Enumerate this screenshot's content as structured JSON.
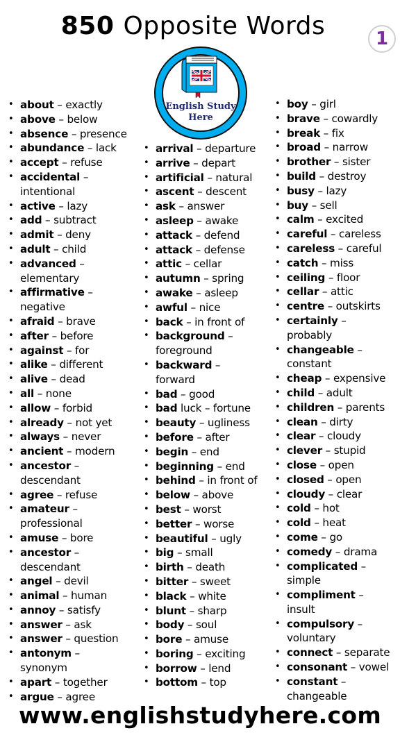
{
  "header": {
    "title_number": "850",
    "title_text": "Opposite Words",
    "page_badge": "1",
    "logo_text_line1": "English Study",
    "logo_text_line2": "Here"
  },
  "colors": {
    "logo_ring": "#00aeef",
    "logo_text": "#1f2a6b",
    "badge_number": "#7b2d9b",
    "text": "#000000"
  },
  "columns": [
    [
      {
        "word": "about",
        "extra": "",
        "opposite": "exactly"
      },
      {
        "word": "above",
        "extra": "",
        "opposite": "below"
      },
      {
        "word": "absence",
        "extra": "",
        "opposite": "presence"
      },
      {
        "word": "abundance",
        "extra": "",
        "opposite": "lack"
      },
      {
        "word": "accept",
        "extra": "",
        "opposite": "refuse"
      },
      {
        "word": "accidental",
        "extra": "",
        "opposite": "intentional",
        "wrap": true
      },
      {
        "word": "active",
        "extra": "",
        "opposite": "lazy"
      },
      {
        "word": "add",
        "extra": "",
        "opposite": "subtract"
      },
      {
        "word": "admit",
        "extra": "",
        "opposite": "deny"
      },
      {
        "word": "adult",
        "extra": "",
        "opposite": "child"
      },
      {
        "word": "advanced",
        "extra": "",
        "opposite": "elementary",
        "wrap": true
      },
      {
        "word": "affirmative",
        "extra": "",
        "opposite": "negative",
        "wrap": true
      },
      {
        "word": "afraid",
        "extra": "",
        "opposite": "brave"
      },
      {
        "word": "after",
        "extra": "",
        "opposite": "before"
      },
      {
        "word": "against",
        "extra": "",
        "opposite": "for"
      },
      {
        "word": "alike",
        "extra": "",
        "opposite": "different"
      },
      {
        "word": "alive",
        "extra": "",
        "opposite": "dead"
      },
      {
        "word": "all",
        "extra": "",
        "opposite": "none"
      },
      {
        "word": "allow",
        "extra": "",
        "opposite": "forbid"
      },
      {
        "word": "already",
        "extra": "",
        "opposite": "not yet"
      },
      {
        "word": "always",
        "extra": "",
        "opposite": "never"
      },
      {
        "word": "ancient",
        "extra": "",
        "opposite": "modern"
      },
      {
        "word": "ancestor",
        "extra": "",
        "opposite": "descendant",
        "wrap": true
      },
      {
        "word": "agree",
        "extra": "",
        "opposite": "refuse"
      },
      {
        "word": "amateur",
        "extra": "",
        "opposite": "professional",
        "wrap": true
      },
      {
        "word": "amuse",
        "extra": "",
        "opposite": "bore"
      },
      {
        "word": "ancestor",
        "extra": "",
        "opposite": "descendant",
        "wrap": true
      },
      {
        "word": "angel",
        "extra": "",
        "opposite": "devil"
      },
      {
        "word": "animal",
        "extra": "",
        "opposite": "human"
      },
      {
        "word": "annoy",
        "extra": "",
        "opposite": "satisfy"
      },
      {
        "word": "answer",
        "extra": "",
        "opposite": "ask"
      },
      {
        "word": "answer",
        "extra": "",
        "opposite": "question"
      },
      {
        "word": "antonym",
        "extra": "",
        "opposite": "synonym",
        "wrap": true
      },
      {
        "word": "apart",
        "extra": "",
        "opposite": "together"
      },
      {
        "word": "argue",
        "extra": "",
        "opposite": "agree"
      }
    ],
    [
      {
        "word": "arrival",
        "extra": "",
        "opposite": "departure"
      },
      {
        "word": "arrive",
        "extra": "",
        "opposite": "depart"
      },
      {
        "word": "artificial",
        "extra": "",
        "opposite": "natural"
      },
      {
        "word": "ascent",
        "extra": "",
        "opposite": "descent"
      },
      {
        "word": "ask",
        "extra": "",
        "opposite": "answer"
      },
      {
        "word": "asleep",
        "extra": "",
        "opposite": "awake"
      },
      {
        "word": "attack",
        "extra": "",
        "opposite": "defend"
      },
      {
        "word": "attack",
        "extra": "",
        "opposite": "defense"
      },
      {
        "word": "attic",
        "extra": "",
        "opposite": "cellar"
      },
      {
        "word": "autumn",
        "extra": "",
        "opposite": "spring"
      },
      {
        "word": "awake",
        "extra": "",
        "opposite": "asleep"
      },
      {
        "word": "awful",
        "extra": "",
        "opposite": "nice"
      },
      {
        "word": "back",
        "extra": "",
        "opposite": "in front of"
      },
      {
        "word": "background",
        "extra": "",
        "opposite": "foreground",
        "wrap": true
      },
      {
        "word": "backward",
        "extra": "",
        "opposite": "forward",
        "wrap": true
      },
      {
        "word": "bad",
        "extra": "",
        "opposite": "good"
      },
      {
        "word": "bad",
        "extra": " luck",
        "opposite": "fortune"
      },
      {
        "word": "beauty",
        "extra": "",
        "opposite": "ugliness"
      },
      {
        "word": "before",
        "extra": "",
        "opposite": "after"
      },
      {
        "word": "begin",
        "extra": "",
        "opposite": "end"
      },
      {
        "word": "beginning",
        "extra": "",
        "opposite": "end"
      },
      {
        "word": "behind",
        "extra": "",
        "opposite": "in front of"
      },
      {
        "word": "below",
        "extra": "",
        "opposite": "above"
      },
      {
        "word": "best",
        "extra": "",
        "opposite": "worst"
      },
      {
        "word": "better",
        "extra": "",
        "opposite": "worse"
      },
      {
        "word": "beautiful",
        "extra": "",
        "opposite": "ugly"
      },
      {
        "word": "big",
        "extra": "",
        "opposite": "small"
      },
      {
        "word": "birth",
        "extra": "",
        "opposite": "death"
      },
      {
        "word": "bitter",
        "extra": "",
        "opposite": "sweet"
      },
      {
        "word": "black",
        "extra": "",
        "opposite": "white"
      },
      {
        "word": "blunt",
        "extra": "",
        "opposite": "sharp"
      },
      {
        "word": "body",
        "extra": "",
        "opposite": "soul"
      },
      {
        "word": "bore",
        "extra": "",
        "opposite": "amuse"
      },
      {
        "word": "boring",
        "extra": "",
        "opposite": "exciting"
      },
      {
        "word": "borrow",
        "extra": "",
        "opposite": "lend"
      },
      {
        "word": "bottom",
        "extra": "",
        "opposite": "top"
      }
    ],
    [
      {
        "word": "boy",
        "extra": "",
        "opposite": "girl"
      },
      {
        "word": "brave",
        "extra": "",
        "opposite": "cowardly"
      },
      {
        "word": "break",
        "extra": "",
        "opposite": "fix"
      },
      {
        "word": "broad",
        "extra": "",
        "opposite": "narrow"
      },
      {
        "word": "brother",
        "extra": "",
        "opposite": "sister"
      },
      {
        "word": "build",
        "extra": "",
        "opposite": "destroy"
      },
      {
        "word": "busy",
        "extra": "",
        "opposite": "lazy"
      },
      {
        "word": "buy",
        "extra": "",
        "opposite": "sell"
      },
      {
        "word": "calm",
        "extra": "",
        "opposite": "excited"
      },
      {
        "word": "careful",
        "extra": "",
        "opposite": "careless"
      },
      {
        "word": "careless",
        "extra": "",
        "opposite": "careful"
      },
      {
        "word": "catch",
        "extra": "",
        "opposite": "miss"
      },
      {
        "word": "ceiling",
        "extra": "",
        "opposite": "floor"
      },
      {
        "word": "cellar",
        "extra": "",
        "opposite": "attic"
      },
      {
        "word": "centre",
        "extra": "",
        "opposite": "outskirts"
      },
      {
        "word": "certainly",
        "extra": "",
        "opposite": "probably",
        "wrap": true
      },
      {
        "word": "changeable",
        "extra": "",
        "opposite": "constant",
        "wrap": true
      },
      {
        "word": "cheap",
        "extra": "",
        "opposite": "expensive"
      },
      {
        "word": "child",
        "extra": "",
        "opposite": "adult"
      },
      {
        "word": "children",
        "extra": "",
        "opposite": "parents"
      },
      {
        "word": "clean",
        "extra": "",
        "opposite": "dirty"
      },
      {
        "word": "clear",
        "extra": "",
        "opposite": "cloudy"
      },
      {
        "word": "clever",
        "extra": "",
        "opposite": "stupid"
      },
      {
        "word": "close",
        "extra": "",
        "opposite": "open"
      },
      {
        "word": "closed",
        "extra": "",
        "opposite": "open"
      },
      {
        "word": "cloudy",
        "extra": "",
        "opposite": "clear"
      },
      {
        "word": "cold",
        "extra": "",
        "opposite": "hot"
      },
      {
        "word": "cold",
        "extra": "",
        "opposite": "heat"
      },
      {
        "word": "come",
        "extra": "",
        "opposite": "go"
      },
      {
        "word": "comedy",
        "extra": "",
        "opposite": "drama"
      },
      {
        "word": "complicated",
        "extra": "",
        "opposite": "simple",
        "wrap": true
      },
      {
        "word": "compliment",
        "extra": "",
        "opposite": "insult",
        "wrap": true
      },
      {
        "word": "compulsory",
        "extra": "",
        "opposite": "voluntary",
        "wrap": true
      },
      {
        "word": "connect",
        "extra": "",
        "opposite": "separate"
      },
      {
        "word": "consonant",
        "extra": "",
        "opposite": "vowel"
      },
      {
        "word": "constant",
        "extra": "",
        "opposite": "changeable",
        "wrap": true
      }
    ]
  ],
  "separator": "–",
  "footer": {
    "url": "www.englishstudyhere.com"
  }
}
